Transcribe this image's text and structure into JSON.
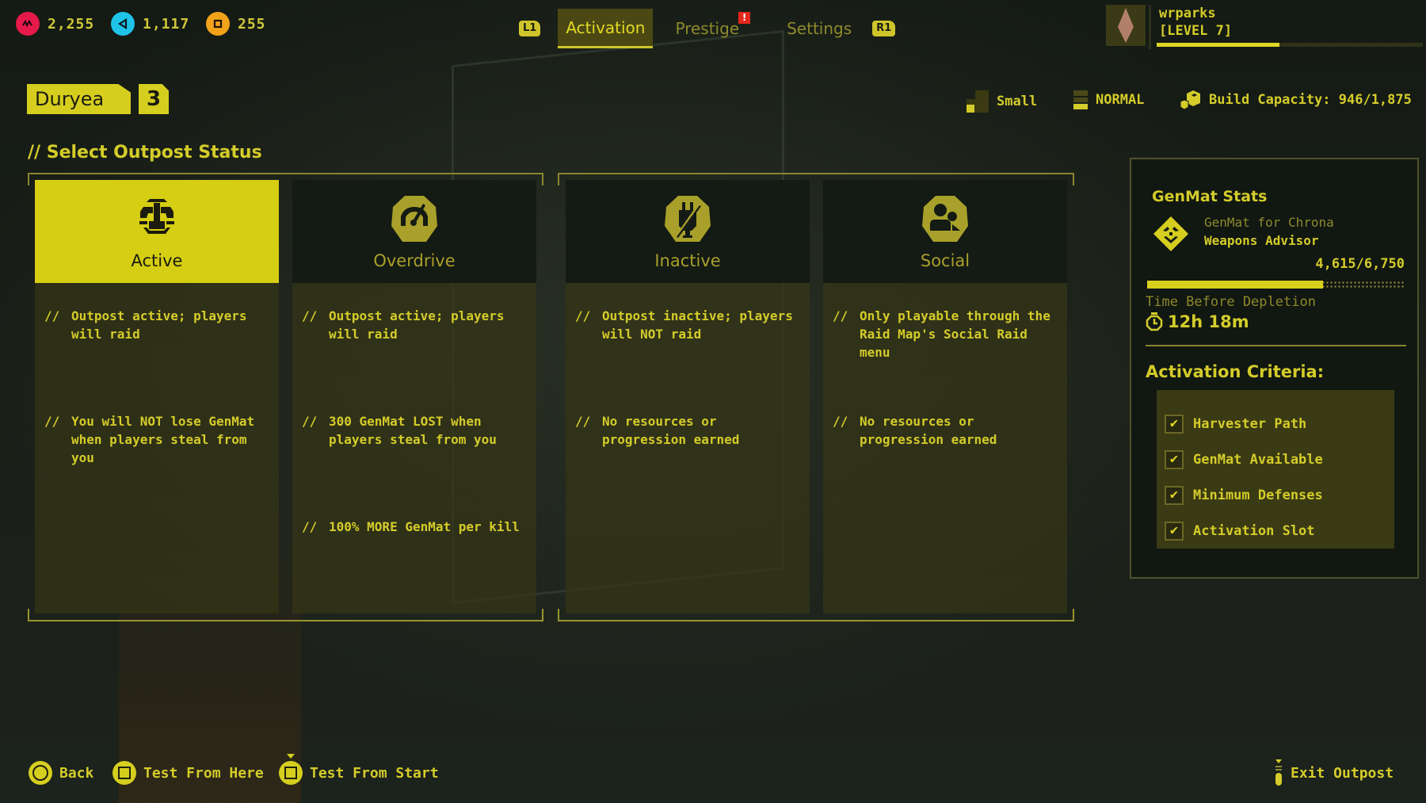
{
  "currencies": [
    {
      "name": "red-currency",
      "value": "2,255",
      "color": "#e5194a"
    },
    {
      "name": "blue-currency",
      "value": "1,117",
      "color": "#1fc3e8"
    },
    {
      "name": "orange-currency",
      "value": "255",
      "color": "#f2a31a"
    }
  ],
  "tabs": {
    "left_bumper": "L1",
    "right_bumper": "R1",
    "items": [
      {
        "label": "Activation",
        "active": true
      },
      {
        "label": "Prestige",
        "alert": "!"
      },
      {
        "label": "Settings"
      }
    ]
  },
  "profile": {
    "username": "wrparks",
    "level": "[LEVEL 7]",
    "xp_progress_percent": 46
  },
  "outpost": {
    "name": "Duryea",
    "number": "3",
    "size": "Small",
    "difficulty": "NORMAL",
    "build_capacity": "Build Capacity: 946/1,875"
  },
  "section_title": "// Select Outpost Status",
  "statuses": [
    {
      "label": "Active",
      "icon": "power-icon",
      "selected": true,
      "bullets": [
        "Outpost active; players will raid",
        "You will NOT lose GenMat when players steal from you"
      ]
    },
    {
      "label": "Overdrive",
      "icon": "speedometer-icon",
      "selected": false,
      "bullets": [
        "Outpost active; players will raid",
        "300 GenMat LOST when players steal from you",
        "100% MORE GenMat per kill"
      ]
    },
    {
      "label": "Inactive",
      "icon": "unplugged-icon",
      "selected": false,
      "bullets": [
        "Outpost inactive; players will NOT raid",
        "No resources or progression earned"
      ]
    },
    {
      "label": "Social",
      "icon": "people-icon",
      "selected": false,
      "bullets": [
        "Only playable through the Raid Map's Social Raid menu",
        "No resources or progression earned"
      ]
    }
  ],
  "bullet_prefix": "//",
  "genmat": {
    "title": "GenMat Stats",
    "subtitle": "GenMat for Chrona",
    "advisor": "Weapons Advisor",
    "count": "4,615/6,750",
    "fill_fraction": 0.684,
    "depletion_label": "Time Before Depletion",
    "depletion_time": "12h 18m"
  },
  "criteria": {
    "title": "Activation Criteria:",
    "items": [
      {
        "label": "Harvester Path",
        "checked": true
      },
      {
        "label": "GenMat Available",
        "checked": true
      },
      {
        "label": "Minimum Defenses",
        "checked": true
      },
      {
        "label": "Activation Slot",
        "checked": true
      }
    ]
  },
  "footer": {
    "back": "Back",
    "test_here": "Test From Here",
    "test_start": "Test From Start",
    "exit": "Exit Outpost"
  },
  "check_glyph": "✔"
}
